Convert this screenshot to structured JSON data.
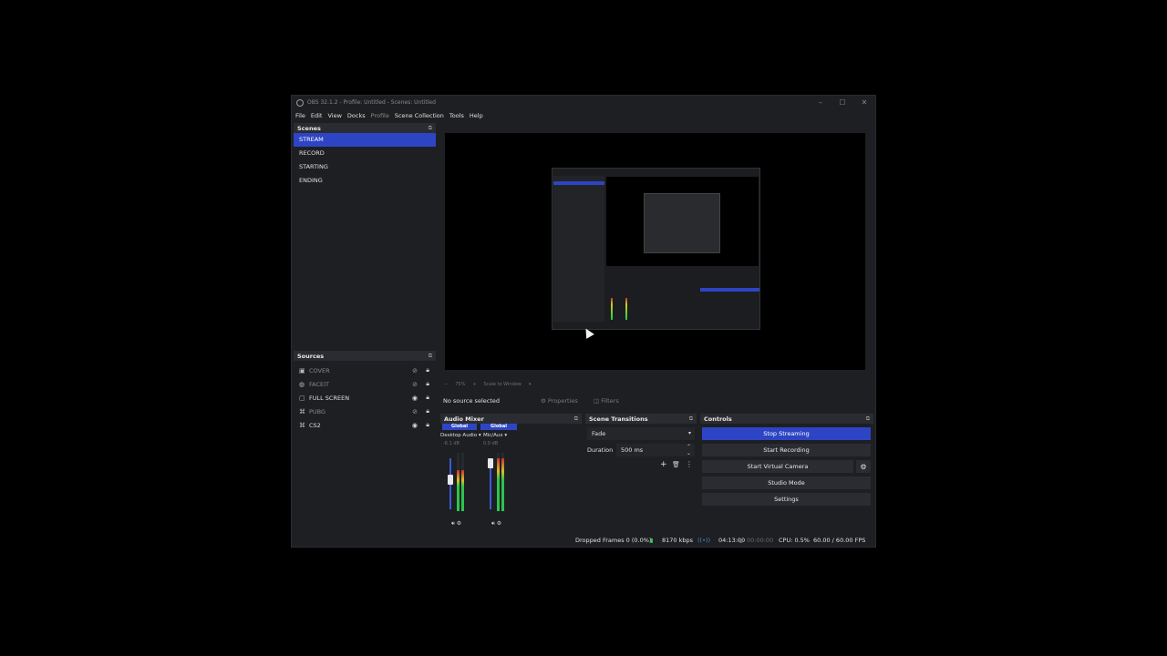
{
  "window": {
    "title": "OBS 32.1.2 - Profile: Untitled - Scenes: Untitled",
    "controls": [
      "–",
      "☐",
      "✕"
    ]
  },
  "menu": {
    "items": [
      "File",
      "Edit",
      "View",
      "Docks",
      "Profile",
      "Scene Collection",
      "Tools",
      "Help"
    ]
  },
  "scenes": {
    "header": "Scenes",
    "items": [
      "STREAM",
      "RECORD",
      "STARTING",
      "ENDING"
    ],
    "active_index": 0
  },
  "sources": {
    "header": "Sources",
    "items": [
      {
        "label": "COVER",
        "icon": "image-icon",
        "visible": false
      },
      {
        "label": "FACEIT",
        "icon": "browser-icon",
        "visible": false
      },
      {
        "label": "FULL SCREEN",
        "icon": "display-capture-icon",
        "visible": true
      },
      {
        "label": "PUBG",
        "icon": "game-capture-icon",
        "visible": false
      },
      {
        "label": "CS2",
        "icon": "game-capture-icon",
        "visible": true
      }
    ]
  },
  "preview": {
    "toolbar": {
      "zoom_out": "−",
      "zoom_level": "75%",
      "zoom_in": "+",
      "scale_mode": "Scale to Window"
    }
  },
  "context_bar": {
    "no_source": "No source selected",
    "properties": "Properties",
    "filters": "Filters"
  },
  "audio_mixer": {
    "header": "Audio Mixer",
    "channels": [
      {
        "global_label": "Global",
        "name": "Desktop Audio",
        "db": "-6.1 dB",
        "fader_level": 0.6,
        "meter_level": 0.7
      },
      {
        "global_label": "Global",
        "name": "Mic/Aux",
        "db": "0.0 dB",
        "fader_level": 1.0,
        "meter_level": 0.9
      }
    ],
    "meter_scale": [
      "0",
      "-6",
      "-12",
      "-18",
      "-24",
      "-30",
      "-36",
      "-42",
      "-48",
      "-54",
      "-60"
    ]
  },
  "scene_transitions": {
    "header": "Scene Transitions",
    "transition": "Fade",
    "duration_label": "Duration",
    "duration_value": "500 ms"
  },
  "controls": {
    "header": "Controls",
    "stop_streaming": "Stop Streaming",
    "start_recording": "Start Recording",
    "start_virtual_camera": "Start Virtual Camera",
    "studio_mode": "Studio Mode",
    "settings": "Settings"
  },
  "status": {
    "dropped_frames": "Dropped Frames 0 (0.0%)",
    "bitrate": "8170 kbps",
    "stream_time": "04:13:00",
    "record_time": "00:00:00",
    "cpu": "CPU: 0.5%",
    "fps": "60.00 / 60.00 FPS"
  },
  "colors": {
    "accent": "#2d45c5",
    "panel": "#1e1f22",
    "header": "#2b2c31",
    "meter_green": "#2cc44f",
    "meter_yellow": "#d6c02a",
    "meter_red": "#c8332f"
  }
}
